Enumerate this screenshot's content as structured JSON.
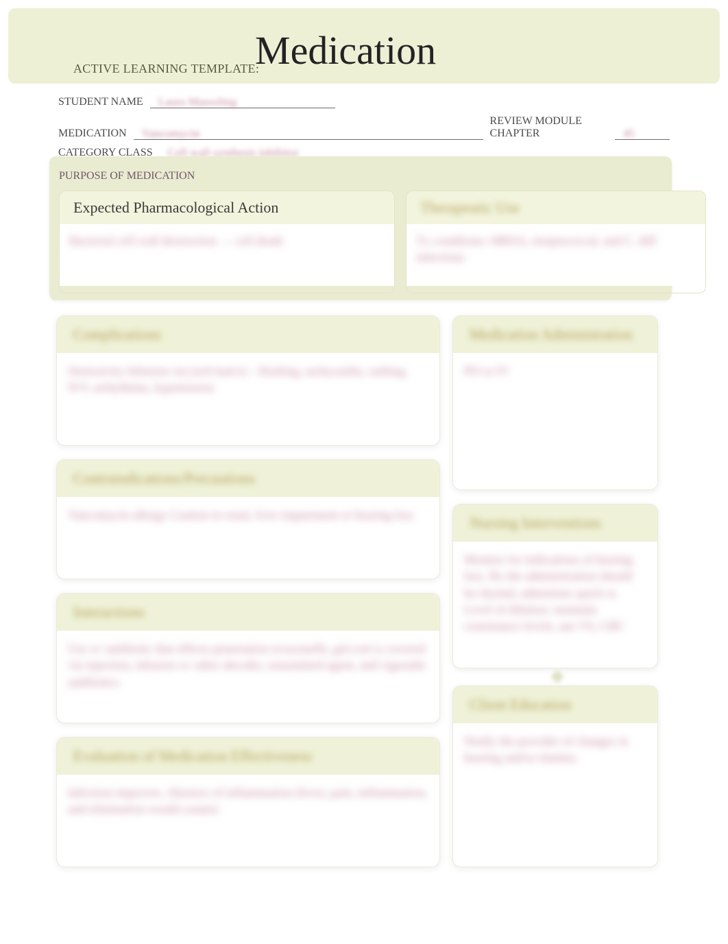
{
  "header": {
    "prefix": "ACTIVE LEARNING TEMPLATE:",
    "title": "Medication"
  },
  "meta": {
    "student_label": "STUDENT NAME",
    "student_value": "Laura Massoling",
    "medication_label": "MEDICATION",
    "medication_value": "Vancomycin",
    "category_label": "CATEGORY CLASS",
    "category_value": "Cell wall synthesis inhibitor",
    "chapter_label": "REVIEW MODULE CHAPTER",
    "chapter_value": "45"
  },
  "purpose": {
    "section_label": "PURPOSE OF MEDICATION",
    "epa": {
      "title": "Expected Pharmacological Action",
      "text": "Bacterial cell wall destruction → cell death"
    },
    "therapeutic": {
      "title": "Therapeutic Use",
      "text": "Tx conditions: MRSA, streptococcal, and C. diff infections"
    }
  },
  "left": {
    "complications": {
      "title": "Complications",
      "text": "Ototoxicity\nInfusion rxn (red man's) – flushing, tachycardia, rashing, N/V, arrhythmia, hypotension"
    },
    "contra": {
      "title": "Contraindications/Precautions",
      "text": "Vancomycin allergy\nCaution in renal, liver impairment or hearing loss"
    },
    "interactions": {
      "title": "Interactions",
      "text": "Use w/ antibiotic that effects penetration ex/aceneffs, gel-cort is covered via injection, infusion w/ other abx/abx, transmitted agent, and vigosalin antibiotics"
    },
    "eval": {
      "title": "Evaluation of Medication Effectiveness",
      "text": "Infection improves.\nAbsence of inflammation (fever, pain, inflammation, and elimination would counts)"
    }
  },
  "right": {
    "medadmin": {
      "title": "Medication Administration",
      "text": "PO or IV"
    },
    "nursing": {
      "title": "Nursing Interventions",
      "text": "Monitor for indications of hearing loss. Rx the administration should be rhytmd, administer quick tx. Level of dilution: maintain consistance levels, ans VS, CBC"
    },
    "clientedu": {
      "title": "Client Education",
      "text": "Notify the provider of changes in hearing and/or tinnitus."
    }
  }
}
